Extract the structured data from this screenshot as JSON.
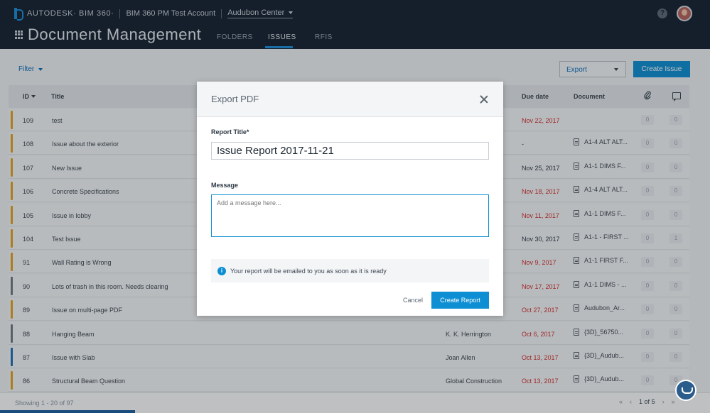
{
  "header": {
    "brand": "AUTODESK· BIM 360·",
    "account": "BIM 360 PM Test Account",
    "project": "Audubon Center",
    "page_title": "Document Management",
    "tabs": [
      {
        "label": "FOLDERS"
      },
      {
        "label": "ISSUES"
      },
      {
        "label": "RFIS"
      }
    ],
    "help_glyph": "?"
  },
  "toolbar": {
    "filter_label": "Filter",
    "export_label": "Export",
    "create_issue_label": "Create Issue"
  },
  "table": {
    "columns": {
      "id": "ID",
      "title": "Title",
      "due": "Due date",
      "document": "Document"
    },
    "rows": [
      {
        "id": "109",
        "title": "test",
        "assignee": "",
        "due": "Nov 22, 2017",
        "overdue": true,
        "doc": "",
        "attach": "0",
        "comments": "0",
        "color": "#e8a21a"
      },
      {
        "id": "108",
        "title": "Issue about the exterior",
        "assignee": "",
        "due": "-",
        "overdue": false,
        "doc": "A1-4 ALT ALT...",
        "attach": "0",
        "comments": "0",
        "color": "#e8a21a"
      },
      {
        "id": "107",
        "title": "New Issue",
        "assignee": "",
        "due": "Nov 25, 2017",
        "overdue": false,
        "doc": "A1-1 DIMS F...",
        "attach": "0",
        "comments": "0",
        "color": "#e8a21a"
      },
      {
        "id": "106",
        "title": "Concrete Specifications",
        "assignee": "",
        "due": "Nov 18, 2017",
        "overdue": true,
        "doc": "A1-4 ALT ALT...",
        "attach": "0",
        "comments": "0",
        "color": "#e8a21a"
      },
      {
        "id": "105",
        "title": "Issue in lobby",
        "assignee": "",
        "due": "Nov 11, 2017",
        "overdue": true,
        "doc": "A1-1 DIMS F...",
        "attach": "0",
        "comments": "0",
        "color": "#e8a21a"
      },
      {
        "id": "104",
        "title": "Test Issue",
        "assignee": "",
        "due": "Nov 30, 2017",
        "overdue": false,
        "doc": "A1-1 - FIRST ...",
        "attach": "0",
        "comments": "1",
        "color": "#e8a21a"
      },
      {
        "id": "91",
        "title": "Wall Rating is Wrong",
        "assignee": "",
        "due": "Nov 9, 2017",
        "overdue": true,
        "doc": "A1-1 FIRST F...",
        "attach": "0",
        "comments": "0",
        "color": "#e8a21a"
      },
      {
        "id": "90",
        "title": "Lots of trash in this room. Needs clearing",
        "assignee": "",
        "due": "Nov 17, 2017",
        "overdue": true,
        "doc": "A1-1 DIMS - ...",
        "attach": "0",
        "comments": "0",
        "color": "#6f7a85"
      },
      {
        "id": "89",
        "title": "Issue on multi-page PDF",
        "assignee": "",
        "due": "Oct 27, 2017",
        "overdue": true,
        "doc": "Audubon_Ar...",
        "attach": "0",
        "comments": "0",
        "color": "#e8a21a"
      },
      {
        "id": "88",
        "title": "Hanging Beam",
        "assignee": "K. K. Herrington",
        "due": "Oct 6, 2017",
        "overdue": true,
        "doc": "{3D}_56750...",
        "attach": "0",
        "comments": "0",
        "color": "#6f7a85"
      },
      {
        "id": "87",
        "title": "Issue with Slab",
        "assignee": "Joan Allen",
        "due": "Oct 13, 2017",
        "overdue": true,
        "doc": "{3D}_Audub...",
        "attach": "0",
        "comments": "0",
        "color": "#1c6fb8"
      },
      {
        "id": "86",
        "title": "Structural Beam Question",
        "assignee": "Global Construction",
        "due": "Oct 13, 2017",
        "overdue": true,
        "doc": "{3D}_Audub...",
        "attach": "0",
        "comments": "0",
        "color": "#e8a21a"
      }
    ]
  },
  "footer": {
    "showing": "Showing 1 - 20 of 97",
    "page": "1",
    "of": "of",
    "pages": "5"
  },
  "modal": {
    "title": "Export PDF",
    "report_title_label": "Report Title*",
    "report_title_value": "Issue Report 2017-11-21",
    "message_label": "Message",
    "message_placeholder": "Add a message here...",
    "info_text": "Your report will be emailed to you as soon as it is ready",
    "info_glyph": "i",
    "cancel_label": "Cancel",
    "create_label": "Create Report"
  },
  "colors": {
    "accent": "#0e8fd3",
    "header_bg": "#15212e",
    "overdue": "#d42d2d"
  }
}
